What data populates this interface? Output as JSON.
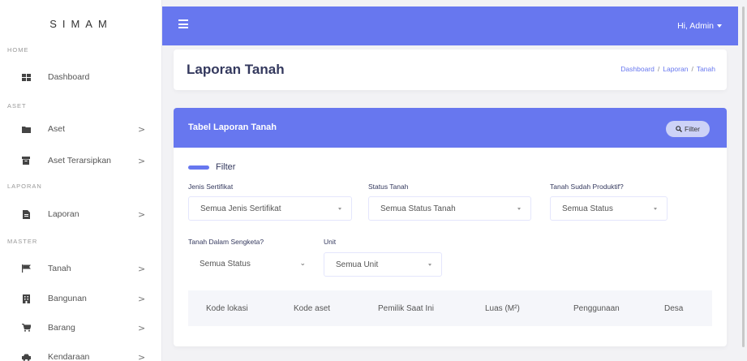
{
  "sidebar": {
    "brand": "SIMAM",
    "sections": {
      "home": "HOME",
      "aset": "ASET",
      "laporan": "LAPORAN",
      "master": "MASTER"
    },
    "items": [
      {
        "label": "Dashboard",
        "icon": "dashboard-icon"
      },
      {
        "label": "Aset",
        "icon": "folder-icon",
        "chevron": ">"
      },
      {
        "label": "Aset Terarsipkan",
        "icon": "archive-icon",
        "chevron": ">"
      },
      {
        "label": "Laporan",
        "icon": "file-icon",
        "chevron": ">"
      },
      {
        "label": "Tanah",
        "icon": "flag-icon",
        "chevron": ">"
      },
      {
        "label": "Bangunan",
        "icon": "building-icon",
        "chevron": ">"
      },
      {
        "label": "Barang",
        "icon": "cart-icon",
        "chevron": ">"
      },
      {
        "label": "Kendaraan",
        "icon": "car-icon",
        "chevron": ">"
      }
    ]
  },
  "topbar": {
    "user_greeting": "Hi, Admin"
  },
  "header": {
    "title": "Laporan Tanah",
    "breadcrumb": [
      "Dashboard",
      "Laporan",
      "Tanah"
    ],
    "breadcrumb_sep": "/"
  },
  "card": {
    "title": "Tabel Laporan Tanah",
    "filter_button": "Filter",
    "filter_heading": "Filter",
    "filters": {
      "jenis_sertifikat": {
        "label": "Jenis Sertifikat",
        "value": "Semua Jenis Sertifikat"
      },
      "status_tanah": {
        "label": "Status Tanah",
        "value": "Semua Status Tanah"
      },
      "produktif": {
        "label": "Tanah Sudah Produktif?",
        "value": "Semua Status"
      },
      "sengketa": {
        "label": "Tanah Dalam Sengketa?",
        "value": "Semua Status"
      },
      "unit": {
        "label": "Unit",
        "value": "Semua Unit"
      }
    },
    "table": {
      "columns": [
        "Kode lokasi",
        "Kode aset",
        "Pemilik Saat Ini",
        "Luas (M²)",
        "Penggunaan",
        "Desa"
      ]
    }
  },
  "colors": {
    "accent": "#6777ef",
    "filter_button_bg": "#cdd2f7",
    "page_bg": "#f2f2f5"
  }
}
